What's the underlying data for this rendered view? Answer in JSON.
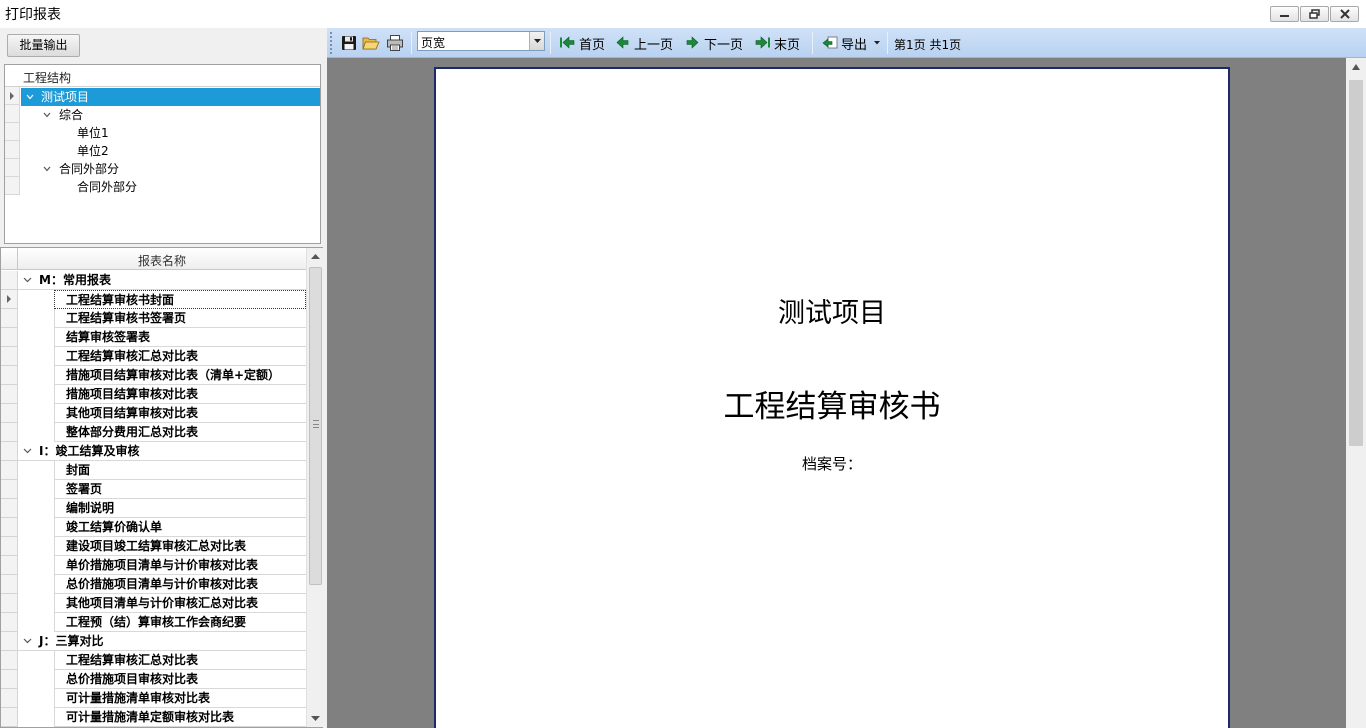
{
  "window": {
    "title": "打印报表"
  },
  "left": {
    "batch_button": "批量输出",
    "tree": {
      "header": "工程结构",
      "nodes": [
        {
          "label": "测试项目",
          "level": 0,
          "expanded": true,
          "selected": true
        },
        {
          "label": "综合",
          "level": 1,
          "expanded": true,
          "selected": false
        },
        {
          "label": "单位1",
          "level": 2,
          "expanded": false,
          "selected": false
        },
        {
          "label": "单位2",
          "level": 2,
          "expanded": false,
          "selected": false
        },
        {
          "label": "合同外部分",
          "level": 1,
          "expanded": true,
          "selected": false
        },
        {
          "label": "合同外部分",
          "level": 2,
          "expanded": false,
          "selected": false
        }
      ]
    },
    "reports": {
      "header": "报表名称",
      "groups": [
        {
          "label": "M：常用报表",
          "items": [
            "工程结算审核书封面",
            "工程结算审核书签署页",
            "结算审核签署表",
            "工程结算审核汇总对比表",
            "措施项目结算审核对比表（清单+定额）",
            "措施项目结算审核对比表",
            "其他项目结算审核对比表",
            "整体部分费用汇总对比表"
          ]
        },
        {
          "label": "I：竣工结算及审核",
          "items": [
            "封面",
            "签署页",
            "编制说明",
            "竣工结算价确认单",
            "建设项目竣工结算审核汇总对比表",
            "单价措施项目清单与计价审核对比表",
            "总价措施项目清单与计价审核对比表",
            "其他项目清单与计价审核汇总对比表",
            "工程预（结）算审核工作会商纪要"
          ]
        },
        {
          "label": "J：三算对比",
          "items": [
            "工程结算审核汇总对比表",
            "总价措施项目审核对比表",
            "可计量措施清单审核对比表",
            "可计量措施清单定额审核对比表"
          ]
        }
      ]
    }
  },
  "toolbar": {
    "zoom_value": "页宽",
    "first_page": "首页",
    "prev_page": "上一页",
    "next_page": "下一页",
    "last_page": "末页",
    "export": "导出",
    "page_info": "第1页 共1页"
  },
  "preview": {
    "project_name": "测试项目",
    "document_title": "工程结算审核书",
    "archive_label": "档案号："
  },
  "colors": {
    "selection": "#1d9bd8",
    "toolbar": "#c4d9f3",
    "preview_bg": "#808080",
    "nav_arrow": "#1a8a3a"
  }
}
